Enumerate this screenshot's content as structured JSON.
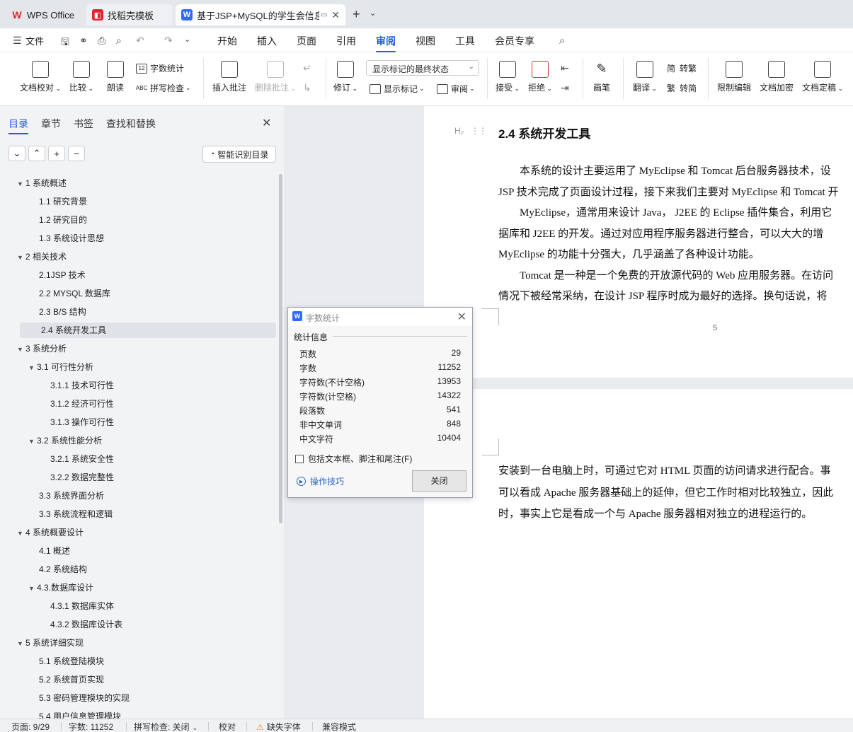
{
  "tabs": [
    {
      "label": "WPS Office"
    },
    {
      "label": "找稻壳模板"
    },
    {
      "label": "基于JSP+MySQL的学生会信息"
    }
  ],
  "menu": {
    "file": "文件",
    "items": [
      "开始",
      "插入",
      "页面",
      "引用",
      "审阅",
      "视图",
      "工具",
      "会员专享"
    ],
    "active": "审阅"
  },
  "ribbon": {
    "doc_check": "文档校对",
    "compare": "比较",
    "read_aloud": "朗读",
    "word_count": "字数统计",
    "spell_check": "拼写检查",
    "insert_comment": "插入批注",
    "delete_comment": "删除批注",
    "revise": "修订",
    "markup_state": "显示标记的最终状态",
    "show_markup": "显示标记",
    "review": "审阅",
    "accept": "接受",
    "reject": "拒绝",
    "pen": "画笔",
    "translate": "翻译",
    "to_traditional": "转繁",
    "to_simplified": "转简",
    "restrict_edit": "限制编辑",
    "encrypt": "文档加密",
    "finalize": "文档定稿"
  },
  "sidebar": {
    "tabs": [
      "目录",
      "章节",
      "书签",
      "查找和替换"
    ],
    "smart_toc": "智能识别目录",
    "toc": [
      {
        "label": "1 系统概述",
        "level": 1,
        "expanded": true
      },
      {
        "label": "1.1  研究背景",
        "level": 2
      },
      {
        "label": "1.2 研究目的",
        "level": 2
      },
      {
        "label": "1.3 系统设计思想",
        "level": 2
      },
      {
        "label": "2 相关技术",
        "level": 1,
        "expanded": true
      },
      {
        "label": "2.1JSP 技术",
        "level": 2
      },
      {
        "label": "2.2 MYSQL 数据库",
        "level": 2
      },
      {
        "label": "2.3 B/S 结构",
        "level": 2
      },
      {
        "label": "2.4  系统开发工具",
        "level": 2,
        "selected": true
      },
      {
        "label": "3 系统分析",
        "level": 1,
        "expanded": true
      },
      {
        "label": "3.1 可行性分析",
        "level": 2,
        "expanded": true
      },
      {
        "label": "3.1.1 技术可行性",
        "level": 3
      },
      {
        "label": "3.1.2 经济可行性",
        "level": 3
      },
      {
        "label": "3.1.3 操作可行性",
        "level": 3
      },
      {
        "label": "3.2 系统性能分析",
        "level": 2,
        "expanded": true
      },
      {
        "label": "3.2.1  系统安全性",
        "level": 3
      },
      {
        "label": "3.2.2  数据完整性",
        "level": 3
      },
      {
        "label": "3.3 系统界面分析",
        "level": 2
      },
      {
        "label": "3.3 系统流程和逻辑",
        "level": 2
      },
      {
        "label": "4 系统概要设计",
        "level": 1,
        "expanded": true
      },
      {
        "label": "4.1 概述",
        "level": 2
      },
      {
        "label": "4.2 系统结构",
        "level": 2
      },
      {
        "label": "4.3.数据库设计",
        "level": 2,
        "expanded": true
      },
      {
        "label": "4.3.1 数据库实体",
        "level": 3
      },
      {
        "label": "4.3.2 数据库设计表",
        "level": 3
      },
      {
        "label": "5 系统详细实现",
        "level": 1,
        "expanded": true
      },
      {
        "label": "5.1  系统登陆模块",
        "level": 2
      },
      {
        "label": "5.2  系统首页实现",
        "level": 2
      },
      {
        "label": "5.3  密码管理模块的实现",
        "level": 2
      },
      {
        "label": "5.4  用户信息管理模块",
        "level": 2
      }
    ]
  },
  "document": {
    "heading": "2.4  系统开发工具",
    "heading_marker": "H₂",
    "page1_lines": [
      "　　本系统的设计主要运用了 MyEclipse 和 Tomcat 后台服务器技术，设",
      "JSP 技术完成了页面设计过程，接下来我们主要对 MyEclipse 和 Tomcat 开",
      "　　MyEclipse，通常用来设计 Java， J2EE 的 Eclipse 插件集合，利用它",
      "据库和 J2EE 的开发。通过对应用程序服务器进行整合，可以大大的增",
      "MyEclipse 的功能十分强大，几乎涵盖了各种设计功能。",
      "　　Tomcat 是一种是一个免费的开放源代码的 Web 应用服务器。在访问",
      "情况下被经常采纳，在设计 JSP 程序时成为最好的选择。换句话说，将"
    ],
    "page_number": "5",
    "page2_lines": [
      "安装到一台电脑上时，可通过它对 HTML 页面的访问请求进行配合。事",
      "可以看成 Apache 服务器基础上的延伸，但它工作时相对比较独立，因此",
      "时，事实上它是看成一个与 Apache 服务器相对独立的进程运行的。"
    ]
  },
  "word_count_dialog": {
    "title": "字数统计",
    "section": "统计信息",
    "rows": [
      {
        "key": "页数",
        "value": "29"
      },
      {
        "key": "字数",
        "value": "11252"
      },
      {
        "key": "字符数(不计空格)",
        "value": "13953"
      },
      {
        "key": "字符数(计空格)",
        "value": "14322"
      },
      {
        "key": "段落数",
        "value": "541"
      },
      {
        "key": "非中文单词",
        "value": "848"
      },
      {
        "key": "中文字符",
        "value": "10404"
      }
    ],
    "checkbox_label": "包括文本框、脚注和尾注(F)",
    "checkbox_checked": false,
    "tips_link": "操作技巧",
    "close_button": "关闭"
  },
  "statusbar": {
    "page": "页面: 9/29",
    "words": "字数: 11252",
    "spell": "拼写检查: 关闭",
    "proof": "校对",
    "missing_font": "缺失字体",
    "compat": "兼容模式"
  },
  "colors": {
    "accent": "#1f5fd6",
    "wps_red": "#e0262b",
    "wps_blue": "#2f6bff"
  }
}
